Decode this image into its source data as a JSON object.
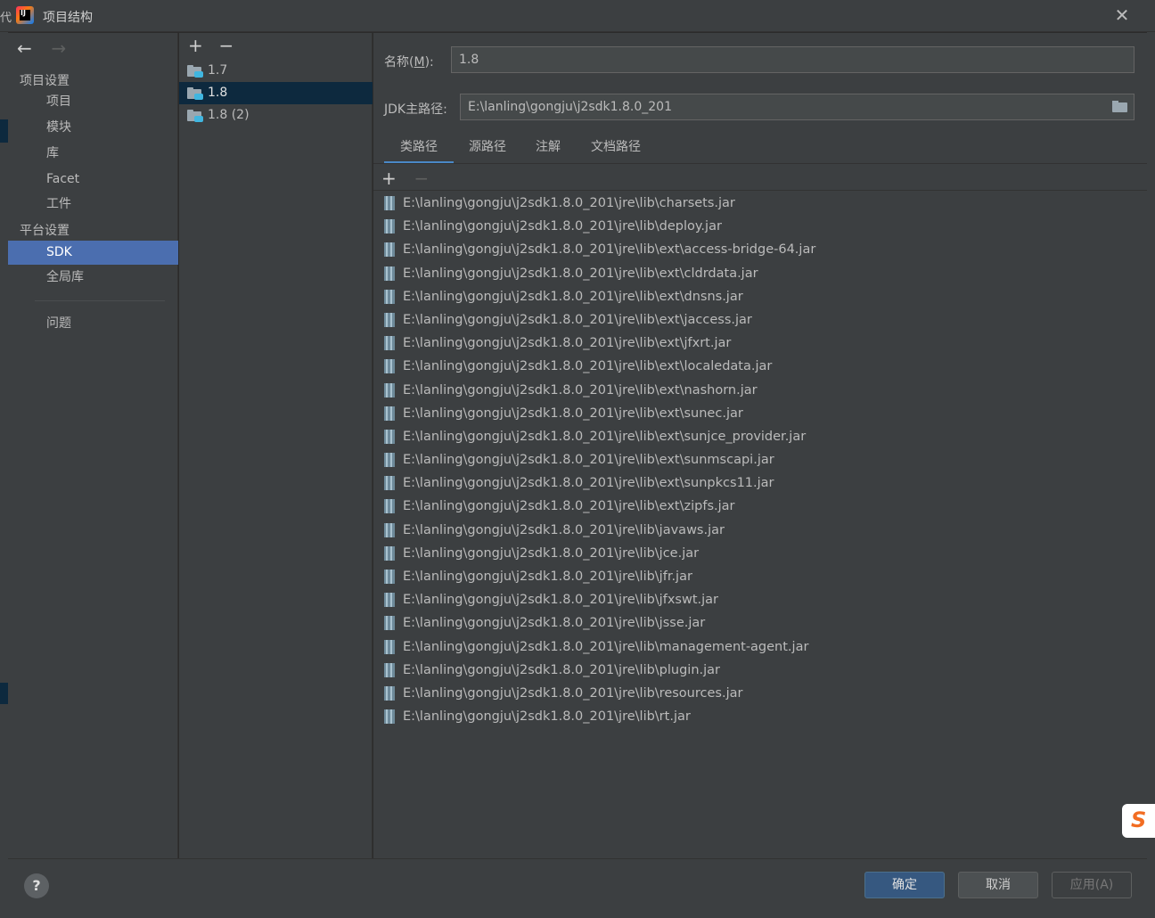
{
  "window": {
    "title": "项目结构",
    "close_label": "✕",
    "bg_fragment": "代"
  },
  "nav": {
    "back": "←",
    "forward": "→"
  },
  "sidebar": {
    "section_project": "项目设置",
    "project_items": [
      "项目",
      "模块",
      "库",
      "Facet",
      "工件"
    ],
    "section_platform": "平台设置",
    "platform_items": [
      "SDK",
      "全局库"
    ],
    "problems": "问题",
    "selected": "SDK"
  },
  "sdk_list": {
    "add": "+",
    "remove": "−",
    "items": [
      "1.7",
      "1.8",
      "1.8 (2)"
    ],
    "selected": "1.8"
  },
  "form": {
    "name_label_prefix": "名称(",
    "name_label_mnemonic": "M",
    "name_label_suffix": "):",
    "name_value": "1.8",
    "home_label": "JDK主路径:",
    "home_value": "E:\\lanling\\gongju\\j2sdk1.8.0_201"
  },
  "tabs": {
    "items": [
      "类路径",
      "源路径",
      "注解",
      "文档路径"
    ],
    "active": "类路径"
  },
  "classpath": {
    "add": "+",
    "remove": "−",
    "paths": [
      "E:\\lanling\\gongju\\j2sdk1.8.0_201\\jre\\lib\\charsets.jar",
      "E:\\lanling\\gongju\\j2sdk1.8.0_201\\jre\\lib\\deploy.jar",
      "E:\\lanling\\gongju\\j2sdk1.8.0_201\\jre\\lib\\ext\\access-bridge-64.jar",
      "E:\\lanling\\gongju\\j2sdk1.8.0_201\\jre\\lib\\ext\\cldrdata.jar",
      "E:\\lanling\\gongju\\j2sdk1.8.0_201\\jre\\lib\\ext\\dnsns.jar",
      "E:\\lanling\\gongju\\j2sdk1.8.0_201\\jre\\lib\\ext\\jaccess.jar",
      "E:\\lanling\\gongju\\j2sdk1.8.0_201\\jre\\lib\\ext\\jfxrt.jar",
      "E:\\lanling\\gongju\\j2sdk1.8.0_201\\jre\\lib\\ext\\localedata.jar",
      "E:\\lanling\\gongju\\j2sdk1.8.0_201\\jre\\lib\\ext\\nashorn.jar",
      "E:\\lanling\\gongju\\j2sdk1.8.0_201\\jre\\lib\\ext\\sunec.jar",
      "E:\\lanling\\gongju\\j2sdk1.8.0_201\\jre\\lib\\ext\\sunjce_provider.jar",
      "E:\\lanling\\gongju\\j2sdk1.8.0_201\\jre\\lib\\ext\\sunmscapi.jar",
      "E:\\lanling\\gongju\\j2sdk1.8.0_201\\jre\\lib\\ext\\sunpkcs11.jar",
      "E:\\lanling\\gongju\\j2sdk1.8.0_201\\jre\\lib\\ext\\zipfs.jar",
      "E:\\lanling\\gongju\\j2sdk1.8.0_201\\jre\\lib\\javaws.jar",
      "E:\\lanling\\gongju\\j2sdk1.8.0_201\\jre\\lib\\jce.jar",
      "E:\\lanling\\gongju\\j2sdk1.8.0_201\\jre\\lib\\jfr.jar",
      "E:\\lanling\\gongju\\j2sdk1.8.0_201\\jre\\lib\\jfxswt.jar",
      "E:\\lanling\\gongju\\j2sdk1.8.0_201\\jre\\lib\\jsse.jar",
      "E:\\lanling\\gongju\\j2sdk1.8.0_201\\jre\\lib\\management-agent.jar",
      "E:\\lanling\\gongju\\j2sdk1.8.0_201\\jre\\lib\\plugin.jar",
      "E:\\lanling\\gongju\\j2sdk1.8.0_201\\jre\\lib\\resources.jar",
      "E:\\lanling\\gongju\\j2sdk1.8.0_201\\jre\\lib\\rt.jar"
    ]
  },
  "buttons": {
    "help": "?",
    "ok": "确定",
    "cancel": "取消",
    "apply": "应用(A)"
  },
  "badge": {
    "letter": "S"
  },
  "colors": {
    "selection": "#4b6eaf",
    "tab_underline": "#4a88c7",
    "ok_button": "#365880",
    "badge": "#f26d22"
  }
}
